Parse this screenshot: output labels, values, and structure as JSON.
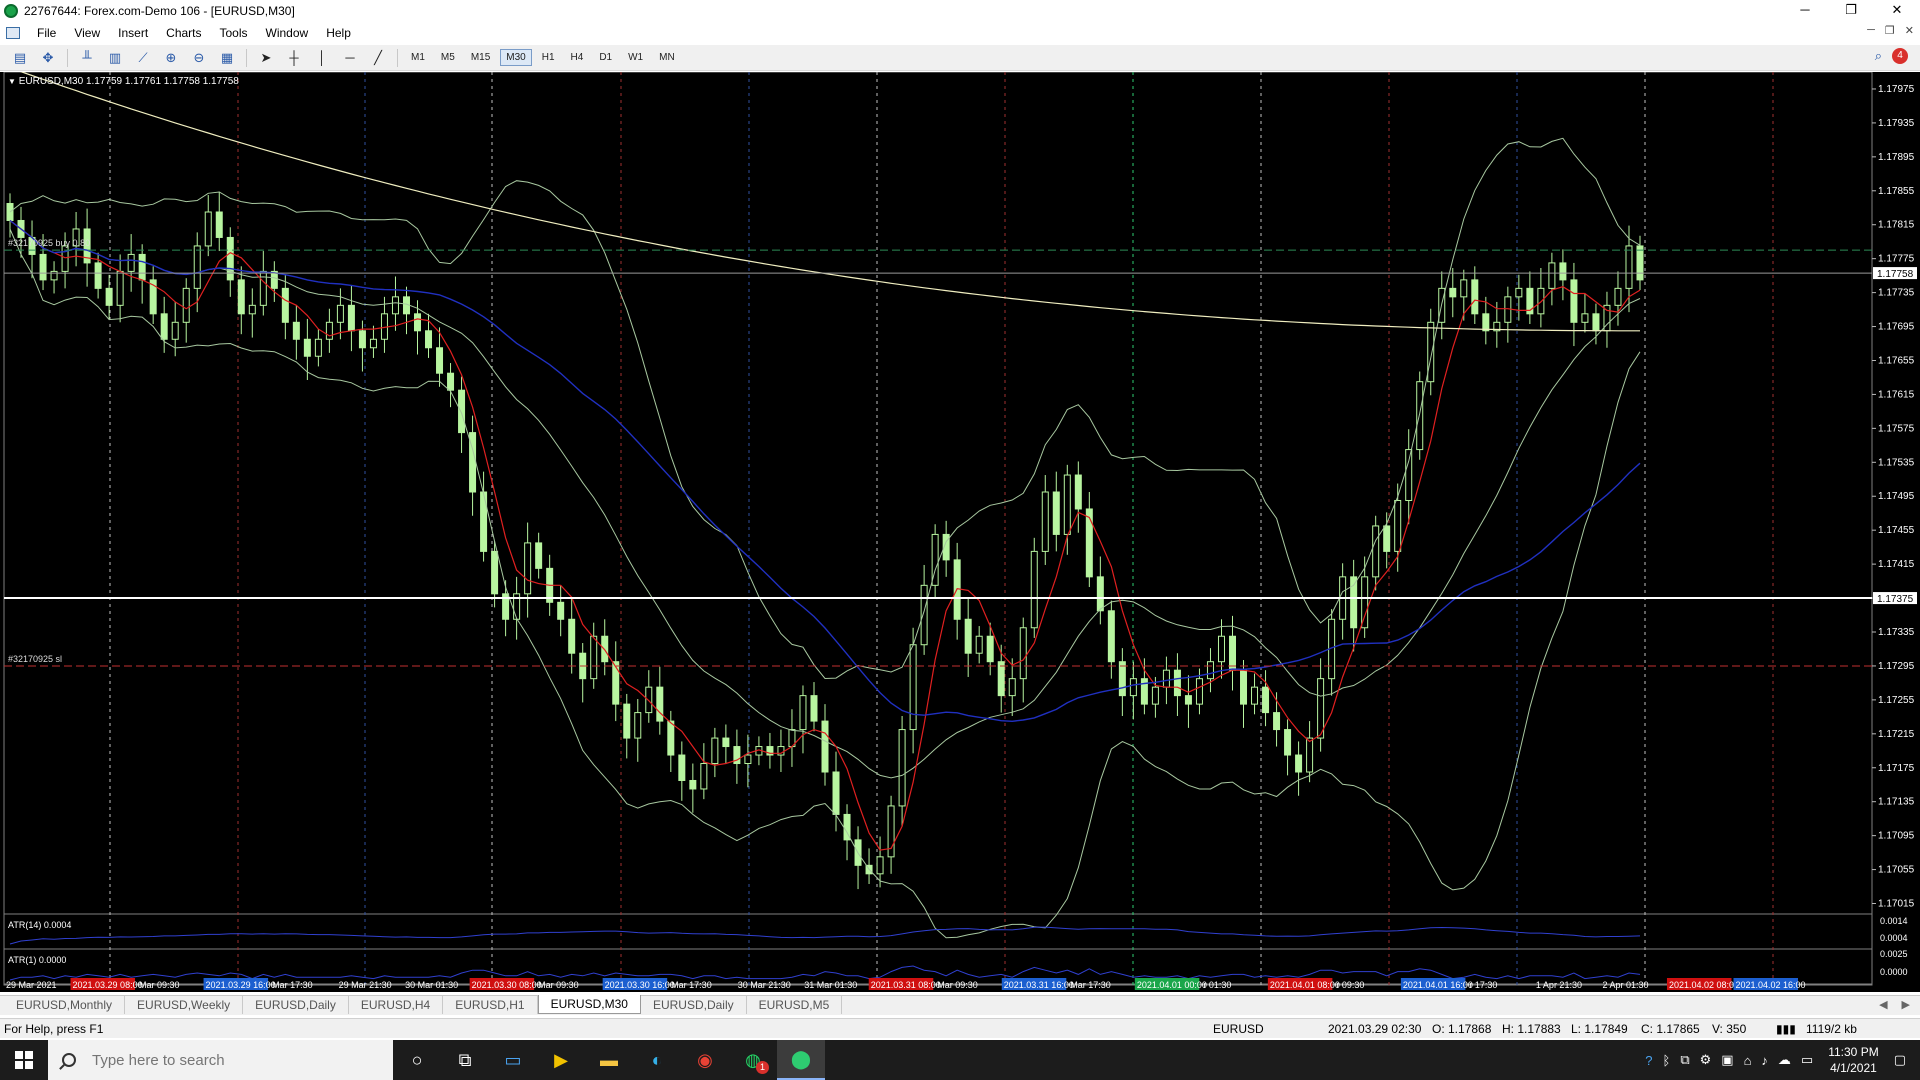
{
  "window": {
    "title": "22767644: Forex.com-Demo 106 - [EURUSD,M30]"
  },
  "menu": [
    "File",
    "View",
    "Insert",
    "Charts",
    "Tools",
    "Window",
    "Help"
  ],
  "timeframes": [
    "M1",
    "M5",
    "M15",
    "M30",
    "H1",
    "H4",
    "D1",
    "W1",
    "MN"
  ],
  "active_timeframe": "M30",
  "notification_count": "4",
  "chart": {
    "header": "EURUSD,M30  1.17759 1.17761 1.17758 1.17758",
    "order_label_buy": "#32170925 buy 0.80",
    "order_label_sl": "#32170925 sl",
    "current_price_label": "1.17758",
    "line_price_label": "1.17375",
    "atr14_label": "ATR(14) 0.0004",
    "atr1_label": "ATR(1) 0.0000",
    "atr14_scale": [
      "0.0014",
      "0.0004"
    ],
    "atr1_scale": [
      "0.0025",
      "0.0000"
    ],
    "price_axis": [
      "1.17975",
      "1.17935",
      "1.17895",
      "1.17855",
      "1.17815",
      "1.17775",
      "1.17735",
      "1.17695",
      "1.17655",
      "1.17615",
      "1.17575",
      "1.17535",
      "1.17495",
      "1.17455",
      "1.17415",
      "1.17375",
      "1.17335",
      "1.17295",
      "1.17255",
      "1.17215",
      "1.17175",
      "1.17135",
      "1.17095",
      "1.17055",
      "1.17015"
    ],
    "time_axis": [
      "29 Mar 2021",
      "2021.03.29 08:00",
      "Mar 09:30",
      "2021.03.29 16:00",
      "Mar 17:30",
      "29 Mar 21:30",
      "30 Mar 01:30",
      "2021.03.30 08:00",
      "Mar 09:30",
      "2021.03.30 16:00",
      "Mar 17:30",
      "30 Mar 21:30",
      "31 Mar 01:30",
      "2021.03.31 08:00",
      "Mar 09:30",
      "2021.03.31 16:00",
      "Mar 17:30",
      "2021.04.01 00:00",
      "r 01:30",
      "2021.04.01 08:00",
      "r 09:30",
      "2021.04.01 16:00",
      "r 17:30",
      "1 Apr 21:30",
      "2 Apr 01:30",
      "2021.04.02 08:00",
      "2021.04.02 16:00"
    ],
    "time_axis_colors": [
      "none",
      "red",
      "none",
      "blue",
      "none",
      "none",
      "none",
      "red",
      "none",
      "blue",
      "none",
      "none",
      "none",
      "red",
      "none",
      "blue",
      "none",
      "green",
      "none",
      "red",
      "none",
      "blue",
      "none",
      "none",
      "none",
      "red",
      "blue"
    ],
    "colors": {
      "candles": "#b8f5a0",
      "bands": "#a8c8a0",
      "ma_fast": "#e02020",
      "ma_slow": "#2030c0",
      "ma_long": "#f0eec0",
      "line": "#ffffff",
      "atr": "#3040d0"
    },
    "close_prices": [
      1.1782,
      1.178,
      1.1778,
      1.1775,
      1.1776,
      1.1779,
      1.1781,
      1.1777,
      1.1774,
      1.1772,
      1.1776,
      1.1778,
      1.1775,
      1.1771,
      1.1768,
      1.177,
      1.1774,
      1.1779,
      1.1783,
      1.178,
      1.1775,
      1.1771,
      1.1772,
      1.1776,
      1.1774,
      1.177,
      1.1768,
      1.1766,
      1.1768,
      1.177,
      1.1772,
      1.1769,
      1.1767,
      1.1768,
      1.1771,
      1.1773,
      1.1771,
      1.1769,
      1.1767,
      1.1764,
      1.1762,
      1.1757,
      1.175,
      1.1743,
      1.1738,
      1.1735,
      1.1738,
      1.1744,
      1.1741,
      1.1737,
      1.1735,
      1.1731,
      1.1728,
      1.1733,
      1.173,
      1.1725,
      1.1721,
      1.1724,
      1.1727,
      1.1723,
      1.1719,
      1.1716,
      1.1715,
      1.1718,
      1.1721,
      1.172,
      1.1718,
      1.1719,
      1.172,
      1.1719,
      1.172,
      1.1722,
      1.1726,
      1.1723,
      1.1717,
      1.1712,
      1.1709,
      1.1706,
      1.1705,
      1.1707,
      1.1713,
      1.1722,
      1.1732,
      1.1739,
      1.1745,
      1.1742,
      1.1735,
      1.1731,
      1.1733,
      1.173,
      1.1726,
      1.1728,
      1.1734,
      1.1743,
      1.175,
      1.1745,
      1.1752,
      1.1748,
      1.174,
      1.1736,
      1.173,
      1.1726,
      1.1728,
      1.1725,
      1.1727,
      1.1729,
      1.1726,
      1.1725,
      1.1728,
      1.173,
      1.1733,
      1.1729,
      1.1725,
      1.1727,
      1.1724,
      1.1722,
      1.1719,
      1.1717,
      1.1721,
      1.1728,
      1.1735,
      1.174,
      1.1734,
      1.174,
      1.1746,
      1.1743,
      1.1749,
      1.1755,
      1.1763,
      1.177,
      1.1774,
      1.1773,
      1.1775,
      1.1771,
      1.1769,
      1.177,
      1.1773,
      1.1774,
      1.1771,
      1.1774,
      1.1777,
      1.1775,
      1.177,
      1.1771,
      1.1769,
      1.1772,
      1.1774,
      1.1779,
      1.1775
    ]
  },
  "tabs": [
    "EURUSD,Monthly",
    "EURUSD,Weekly",
    "EURUSD,Daily",
    "EURUSD,H4",
    "EURUSD,H1",
    "EURUSD,M30",
    "EURUSD,Daily",
    "EURUSD,M5"
  ],
  "active_tab": "EURUSD,M30",
  "status": {
    "help": "For Help, press F1",
    "symbol": "EURUSD",
    "datetime": "2021.03.29 02:30",
    "open": "O: 1.17868",
    "high": "H: 1.17883",
    "low": "L: 1.17849",
    "close": "C: 1.17865",
    "volume": "V: 350",
    "net": "1119/2 kb"
  },
  "taskbar": {
    "search_placeholder": "Type here to search",
    "time": "11:30 PM",
    "date": "4/1/2021",
    "chrome_badge": "1"
  }
}
